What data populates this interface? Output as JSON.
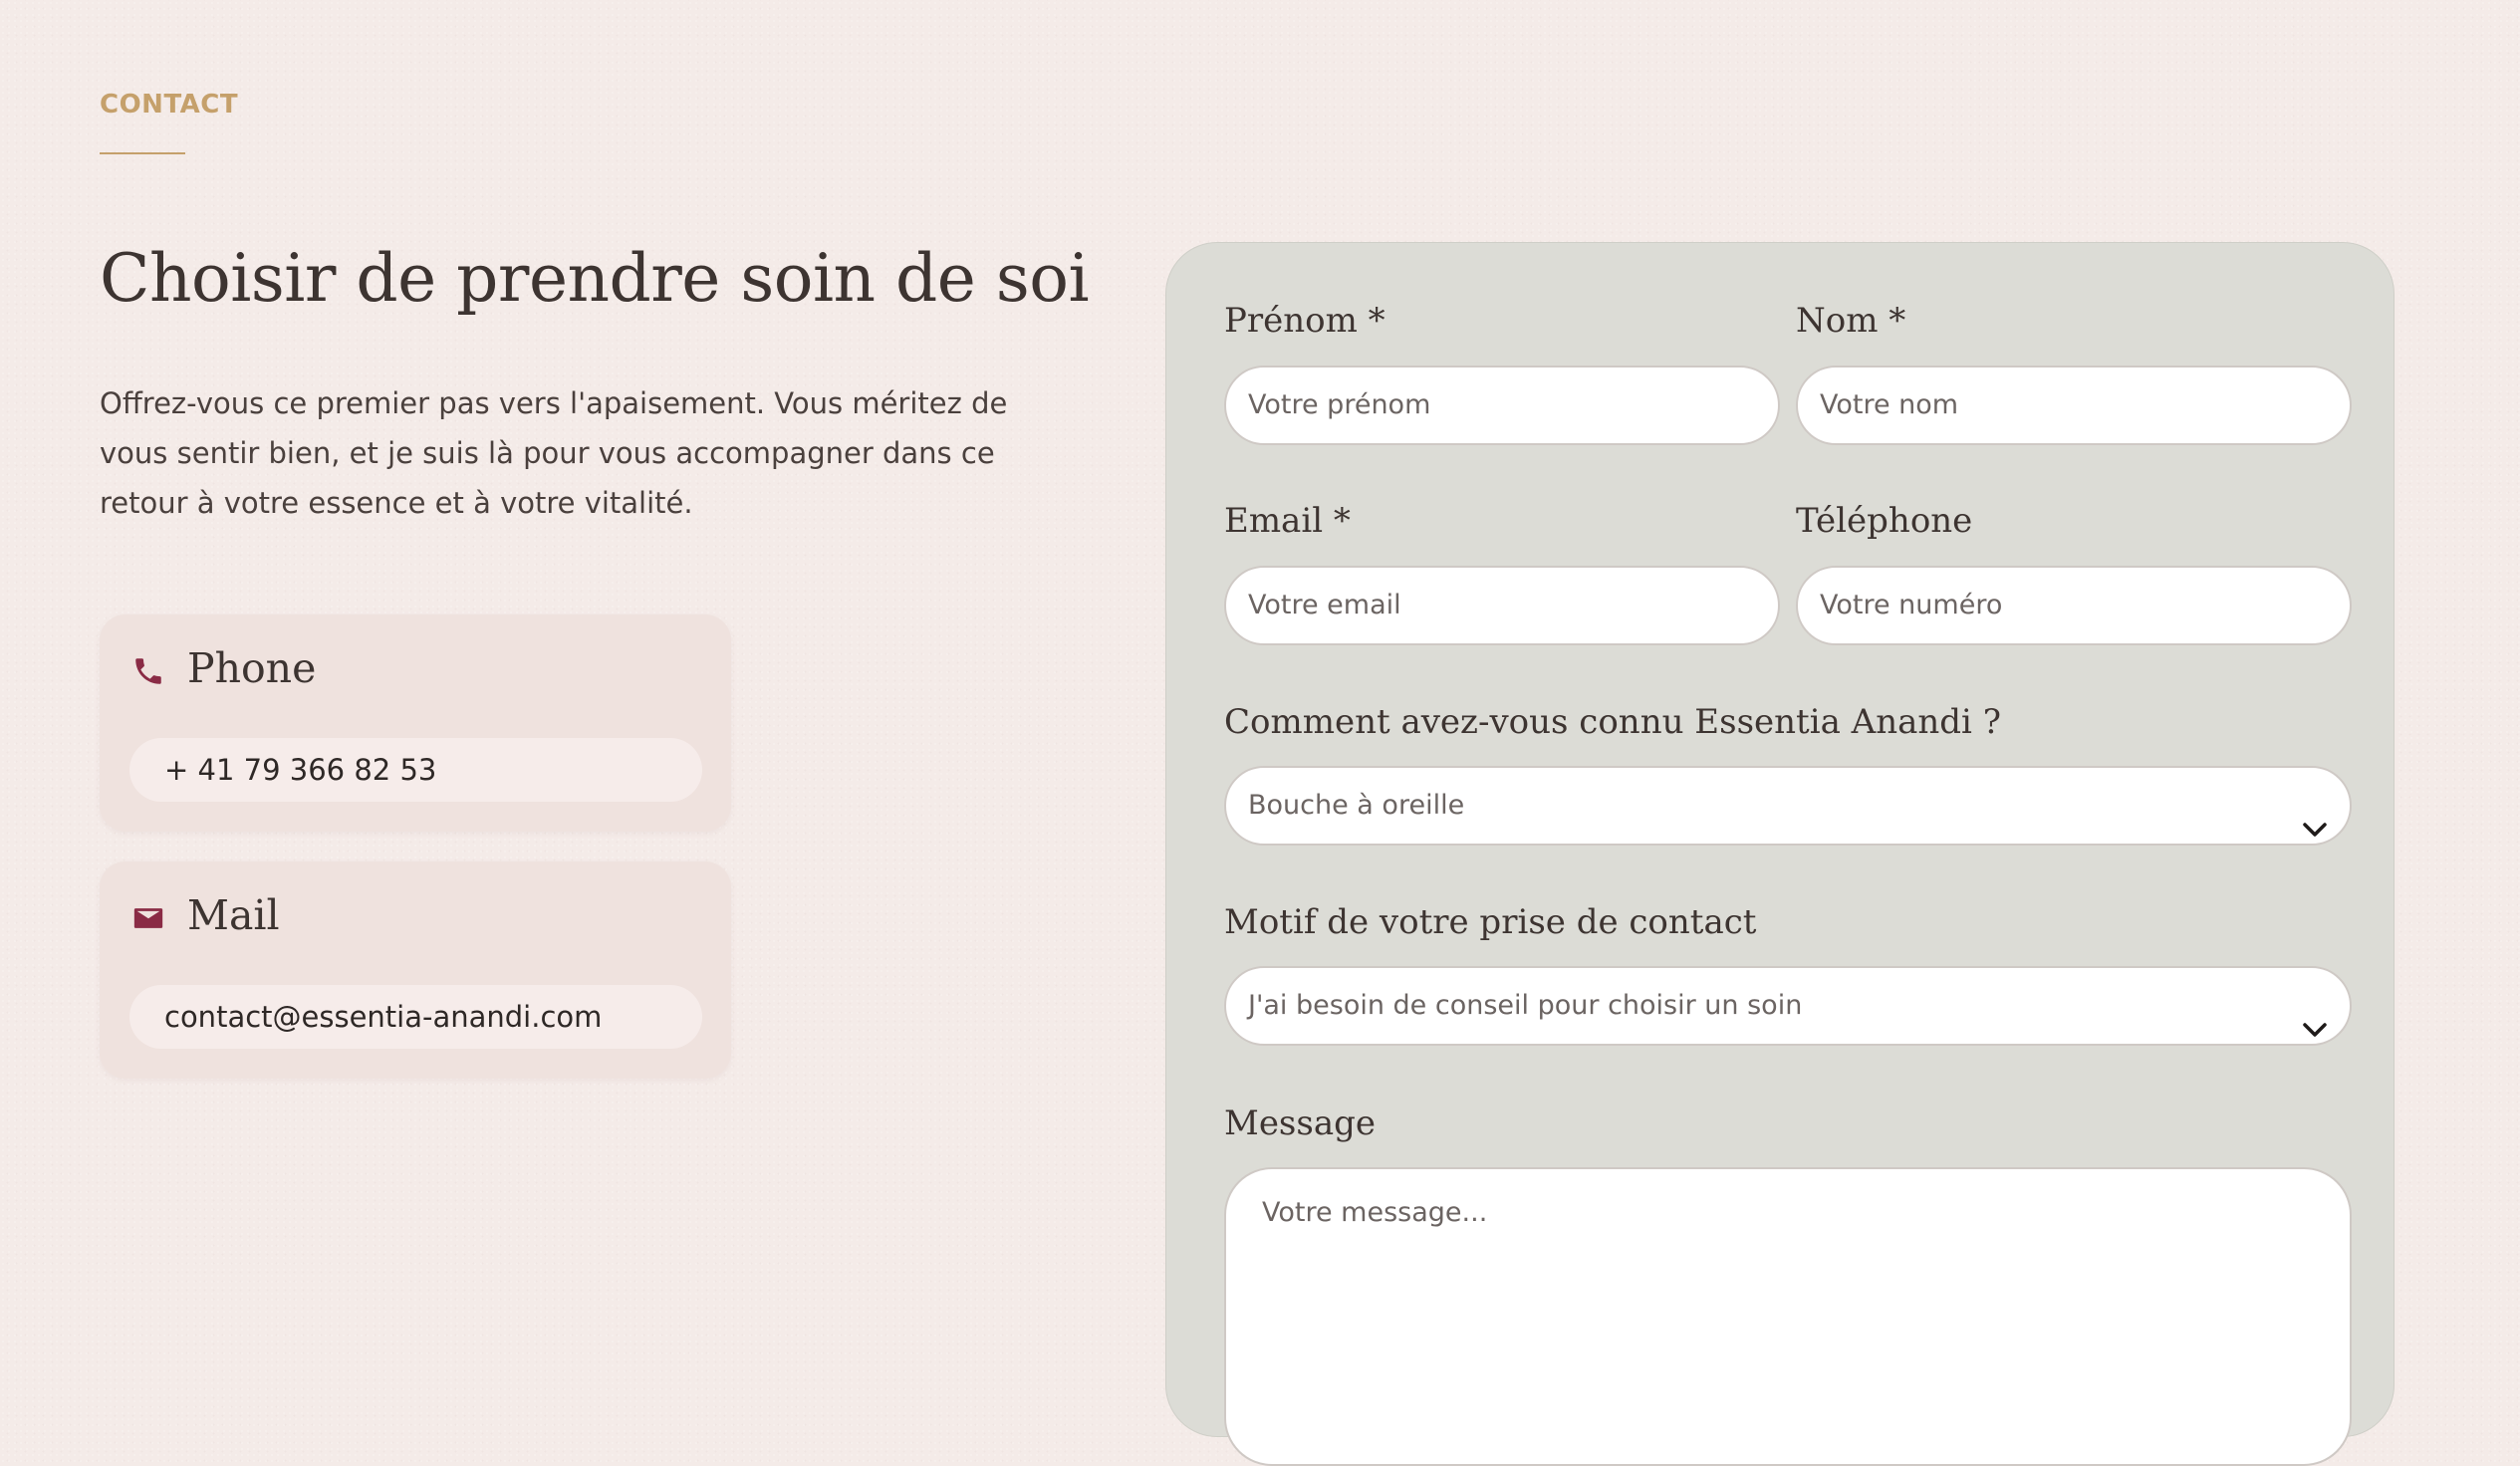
{
  "section": {
    "eyebrow": "CONTACT",
    "headline": "Choisir de prendre soin de soi",
    "intro": "Offrez-vous ce premier pas vers l'apaisement. Vous méritez de vous sentir bien, et je suis là pour vous accompagner dans ce retour à votre essence et à votre vitalité."
  },
  "contact_cards": {
    "phone": {
      "title": "Phone",
      "value": "+ 41 79 366 82 53",
      "icon": "phone-icon"
    },
    "mail": {
      "title": "Mail",
      "value": "contact@essentia-anandi.com",
      "icon": "envelope-icon"
    }
  },
  "form": {
    "first_name": {
      "label": "Prénom *",
      "placeholder": "Votre prénom"
    },
    "last_name": {
      "label": "Nom *",
      "placeholder": "Votre nom"
    },
    "email": {
      "label": "Email *",
      "placeholder": "Votre email"
    },
    "phone": {
      "label": "Téléphone",
      "placeholder": "Votre numéro"
    },
    "source": {
      "label": "Comment avez-vous connu Essentia Anandi ?",
      "selected": "Bouche à oreille"
    },
    "reason": {
      "label": "Motif de votre prise de contact",
      "selected": "J'ai besoin de conseil pour choisir un soin"
    },
    "message": {
      "label": "Message",
      "placeholder": "Votre message..."
    }
  },
  "colors": {
    "background": "#f4ebe8",
    "accent_gold": "#c5a06b",
    "icon_burgundy": "#8a2b45",
    "form_panel": "#dcdcd6",
    "card": "#efe2de"
  }
}
